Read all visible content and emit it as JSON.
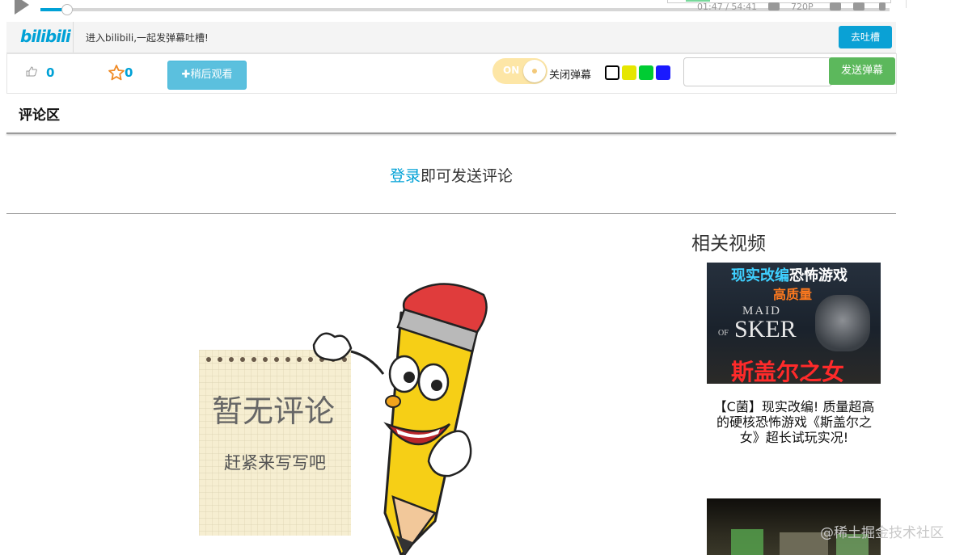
{
  "player": {
    "time": "01:47 / 54:41",
    "quality": "720P"
  },
  "danmaku_bar": {
    "logo": "bilibili",
    "prompt": "进入bilibili,一起发弹幕吐槽!",
    "tucao_label": "去吐槽"
  },
  "toolbar": {
    "like_count": "0",
    "fav_count": "0",
    "watch_later_label": "稍后观看",
    "toggle_text": "ON",
    "toggle_label": "关闭弹幕",
    "swatches": [
      "#ffffff",
      "#e6e600",
      "#00cc33",
      "#1a1aff"
    ],
    "input_placeholder": "",
    "send_label": "发送弹幕"
  },
  "comments": {
    "heading": "评论区",
    "login_link": "登录",
    "login_suffix": "即可发送评论",
    "empty_title": "暂无评论",
    "empty_sub": "赶紧来写写吧"
  },
  "related": {
    "title": "相关视频",
    "videos": [
      {
        "title": "【C菌】现实改编! 质量超高的硬核恐怖游戏《斯盖尔之女》超长试玩实况!",
        "thumb_top": "现实改编",
        "thumb_top2": "恐怖游戏",
        "thumb_mid": "高质量",
        "thumb_logo_1": "MAID",
        "thumb_logo_2": "SKER",
        "thumb_logo_of": "OF",
        "thumb_bottom": "斯盖尔之女"
      },
      {
        "title": ""
      }
    ]
  },
  "watermark": "@稀土掘金技术社区"
}
